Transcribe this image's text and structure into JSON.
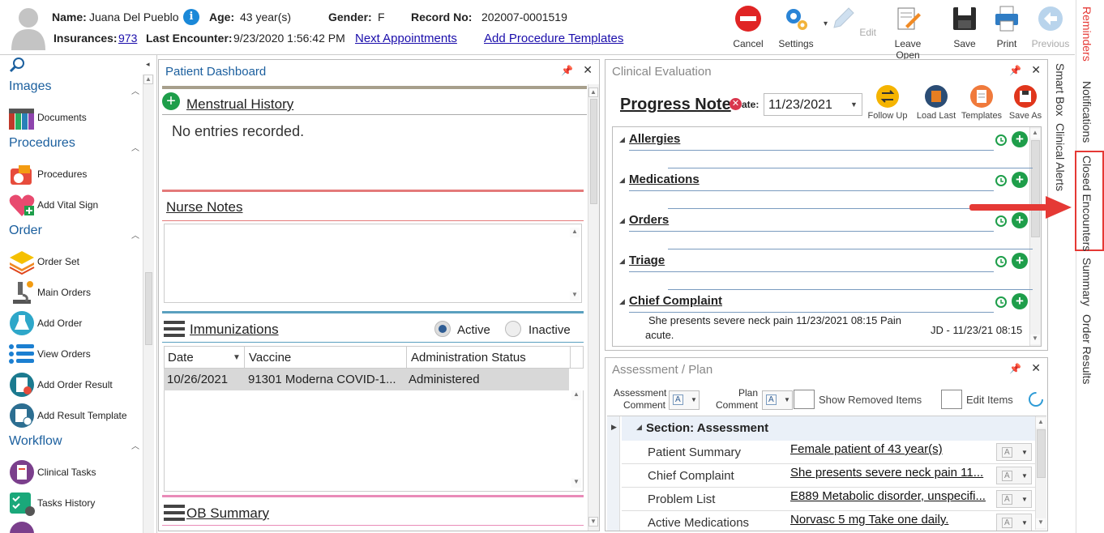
{
  "header": {
    "name_label": "Name:",
    "name": "Juana Del Pueblo",
    "age_label": "Age:",
    "age": "43 year(s)",
    "gender_label": "Gender:",
    "gender": "F",
    "record_label": "Record No:",
    "record": "202007-0001519",
    "insurances_label": "Insurances:",
    "insurances": "973",
    "last_encounter_label": "Last Encounter:",
    "last_encounter": "9/23/2020 1:56:42 PM",
    "next_appointments": "Next Appointments",
    "add_procedure_templates": "Add Procedure Templates"
  },
  "toolbar": {
    "cancel": "Cancel",
    "settings": "Settings",
    "edit": "Edit",
    "leave_open": "Leave Open",
    "save": "Save",
    "print": "Print",
    "previous": "Previous"
  },
  "sidebar": {
    "images": "Images",
    "documents": "Documents",
    "procedures_section": "Procedures",
    "procedures": "Procedures",
    "add_vital_sign": "Add Vital Sign",
    "order_section": "Order",
    "order_set": "Order Set",
    "main_orders": "Main Orders",
    "add_order": "Add Order",
    "view_orders": "View Orders",
    "add_order_result": "Add Order Result",
    "add_result_template": "Add Result Template",
    "workflow_section": "Workflow",
    "clinical_tasks": "Clinical Tasks",
    "tasks_history": "Tasks History"
  },
  "dashboard": {
    "title": "Patient Dashboard",
    "menstrual_history": "Menstrual History",
    "no_entries": "No entries recorded.",
    "nurse_notes": "Nurse Notes",
    "immunizations": "Immunizations",
    "active": "Active",
    "inactive": "Inactive",
    "columns": [
      "Date",
      "Vaccine",
      "Administration Status"
    ],
    "rows": [
      {
        "date": "10/26/2021",
        "vaccine": "91301 Moderna COVID-1...",
        "status": "Administered"
      }
    ],
    "ob_summary": "OB Summary"
  },
  "clinical": {
    "title": "Clinical Evaluation",
    "progress_note": "Progress Note",
    "date_label": "ate:",
    "date": "11/23/2021",
    "buttons": {
      "follow_up": "Follow Up",
      "load_last": "Load Last",
      "templates": "Templates",
      "save_as": "Save As"
    },
    "sections": [
      "Allergies",
      "Medications",
      "Orders",
      "Triage",
      "Chief Complaint"
    ],
    "chief_complaint_text_1": "She presents severe neck pain 11/23/2021 08:15 Pain",
    "chief_complaint_text_2": "acute.",
    "chief_complaint_sig": "JD - 11/23/21 08:15"
  },
  "assessment": {
    "title": "Assessment / Plan",
    "assessment_comment_1": "Assessment",
    "assessment_comment_2": "Comment",
    "plan_comment_1": "Plan",
    "plan_comment_2": "Comment",
    "show_removed": "Show Removed Items",
    "edit_items": "Edit Items",
    "section": "Section: Assessment",
    "rows": [
      {
        "k": "Patient Summary",
        "v": "Female patient of 43 year(s)"
      },
      {
        "k": "Chief Complaint",
        "v": " She presents severe neck pain 11..."
      },
      {
        "k": "Problem List",
        "v": "E889 Metabolic disorder, unspecifi..."
      },
      {
        "k": "Active Medications",
        "v": "Norvasc 5 mg Take one daily."
      }
    ]
  },
  "right_tabs": {
    "smart_box": "Smart Box",
    "clinical_alerts": "Clinical Alerts",
    "reminders": "Reminders",
    "notifications": "Notifications",
    "closed_encounters": "Closed Encounters",
    "summary": "Summary",
    "order_results": "Order Results"
  }
}
